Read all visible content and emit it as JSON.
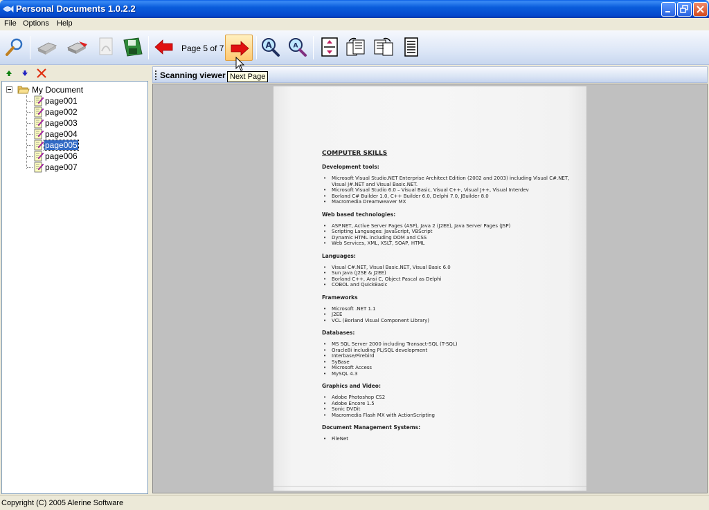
{
  "window": {
    "title": "Personal Documents 1.0.2.2",
    "icons": [
      "app-fish-icon",
      "minimize-icon",
      "maximize-icon",
      "close-icon"
    ]
  },
  "menu": {
    "items": [
      "File",
      "Options",
      "Help"
    ]
  },
  "toolbar": {
    "page_label": "Page 5 of 7",
    "tooltip": "Next Page",
    "icons": [
      "search-icon",
      "scanner-icon",
      "scan-to-printer-icon",
      "pdf-icon",
      "save-icon",
      "previous-page-icon",
      "next-page-icon",
      "zoom-in-icon",
      "zoom-out-icon",
      "fit-page-icon",
      "rotate-left-icon",
      "rotate-right-icon",
      "properties-icon"
    ]
  },
  "tree": {
    "root_label": "My Document",
    "selected_index": 4,
    "items": [
      "page001",
      "page002",
      "page003",
      "page004",
      "page005",
      "page006",
      "page007"
    ],
    "tool_icons": [
      "move-up-icon",
      "move-down-icon",
      "delete-icon"
    ]
  },
  "viewer": {
    "title": "Scanning viewer",
    "document": {
      "title": "COMPUTER SKILLS",
      "sections": [
        {
          "heading": "Development tools:",
          "items": [
            "Microsoft Visual Studio.NET Enterprise Architect Edition (2002 and 2003) including Visual C#.NET, Visual J#.NET and Visual Basic.NET.",
            "Microsoft Visual Studio 6.0 – Visual Basic, Visual C++, Visual J++, Visual Interdev",
            "Borland C# Builder 1.0, C++ Builder 6.0, Delphi 7.0, JBuilder 8.0",
            "Macromedia Dreamweaver MX"
          ]
        },
        {
          "heading": "Web based technologies:",
          "items": [
            "ASP.NET, Active Server Pages (ASP), Java 2 (J2EE), Java Server Pages (JSP)",
            "Scripting Languages: JavaScript, VBScript",
            "Dynamic HTML including DOM and CSS",
            "Web Services, XML, XSLT, SOAP, HTML"
          ]
        },
        {
          "heading": "Languages:",
          "items": [
            "Visual C#.NET, Visual Basic.NET, Visual Basic 6.0",
            "Sun Java (J2SE & J2EE)",
            "Borland C++, Ansi C, Object Pascal as Delphi",
            "COBOL and QuickBasic"
          ]
        },
        {
          "heading": "Frameworks",
          "items": [
            "Microsoft .NET 1.1",
            "J2EE",
            "VCL (Borland Visual Component Library)"
          ]
        },
        {
          "heading": "Databases:",
          "items": [
            "MS SQL Server 2000 including Transact-SQL (T-SQL)",
            "Oracle8i including PL/SQL development",
            "Interbase/Firebird",
            "SyBase",
            "Microsoft Access",
            "MySQL 4.3"
          ]
        },
        {
          "heading": "Graphics and Video:",
          "items": [
            "Adobe Photoshop CS2",
            "Adobe Encore 1.5",
            "Sonic DVDit",
            "Macromedia Flash MX with ActionScripting"
          ]
        },
        {
          "heading": "Document Management Systems:",
          "items": [
            "FileNet"
          ]
        }
      ]
    }
  },
  "status": {
    "text": "Copyright (C) 2005 Alerine Software"
  },
  "colors": {
    "title_bar": "#0a5ddc",
    "selection": "#316ac5",
    "viewer_bg": "#c0c0c0",
    "tooltip_bg": "#ffffe1",
    "arrow_red": "#e01010"
  }
}
